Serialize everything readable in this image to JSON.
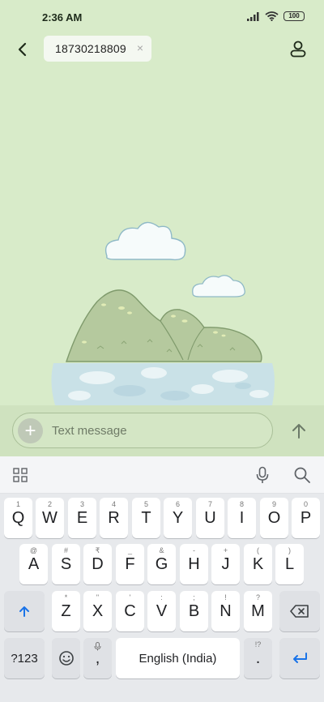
{
  "status_bar": {
    "time": "2:36 AM",
    "battery": "100"
  },
  "header": {
    "recipient": "18730218809",
    "chip_close": "×"
  },
  "compose": {
    "placeholder": "Text message",
    "add_symbol": "+"
  },
  "keyboard": {
    "row1": [
      {
        "letter": "Q",
        "hint": "1"
      },
      {
        "letter": "W",
        "hint": "2"
      },
      {
        "letter": "E",
        "hint": "3"
      },
      {
        "letter": "R",
        "hint": "4"
      },
      {
        "letter": "T",
        "hint": "5"
      },
      {
        "letter": "Y",
        "hint": "6"
      },
      {
        "letter": "U",
        "hint": "7"
      },
      {
        "letter": "I",
        "hint": "8"
      },
      {
        "letter": "O",
        "hint": "9"
      },
      {
        "letter": "P",
        "hint": "0"
      }
    ],
    "row2": [
      {
        "letter": "A",
        "hint": "@"
      },
      {
        "letter": "S",
        "hint": "#"
      },
      {
        "letter": "D",
        "hint": "₹"
      },
      {
        "letter": "F",
        "hint": "_"
      },
      {
        "letter": "G",
        "hint": "&"
      },
      {
        "letter": "H",
        "hint": "-"
      },
      {
        "letter": "J",
        "hint": "+"
      },
      {
        "letter": "K",
        "hint": "("
      },
      {
        "letter": "L",
        "hint": ")"
      }
    ],
    "row3": [
      {
        "letter": "Z",
        "hint": "*"
      },
      {
        "letter": "X",
        "hint": "\""
      },
      {
        "letter": "C",
        "hint": "'"
      },
      {
        "letter": "V",
        "hint": ":"
      },
      {
        "letter": "B",
        "hint": ";"
      },
      {
        "letter": "N",
        "hint": "!"
      },
      {
        "letter": "M",
        "hint": "?"
      }
    ],
    "symbols_key": "?123",
    "comma_key": ",",
    "space_label": "English (India)",
    "period_key": ".",
    "period_hint": "!?"
  }
}
